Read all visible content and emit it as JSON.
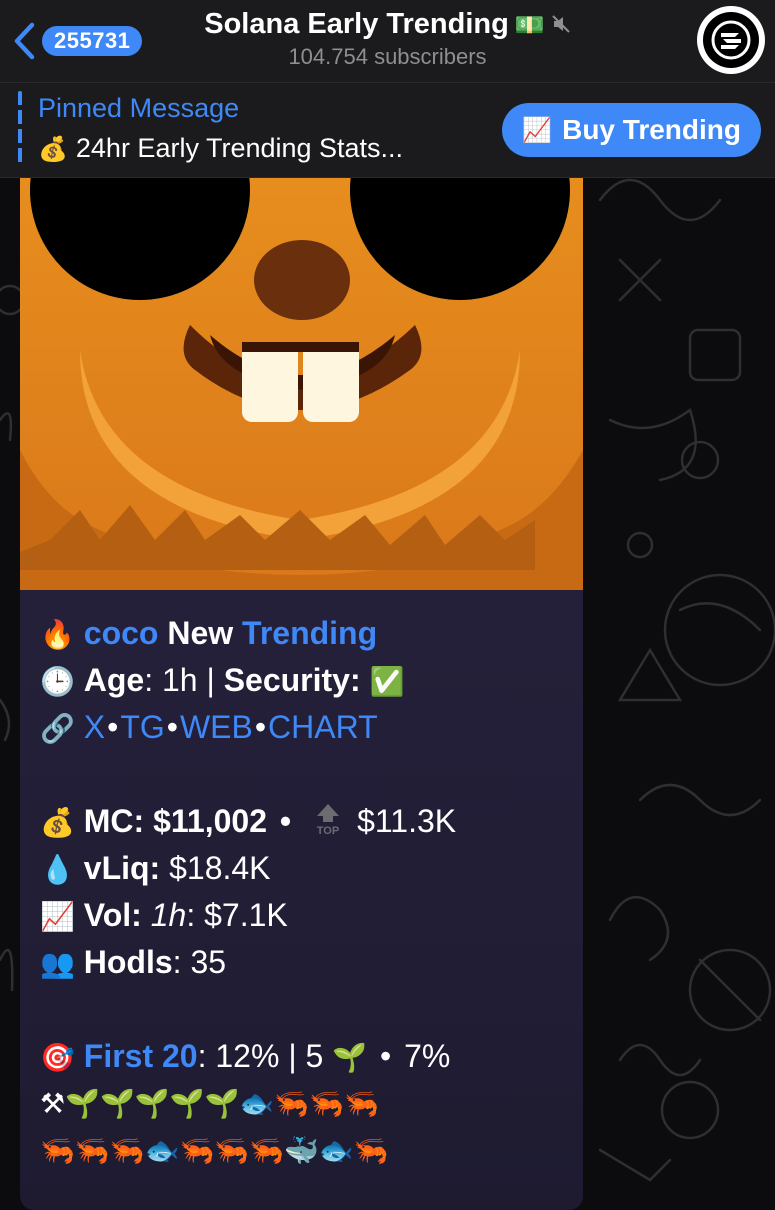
{
  "header": {
    "back_count": "255731",
    "title": "Solana Early Trending",
    "title_emoji": "💵",
    "subtitle": "104.754 subscribers"
  },
  "pinned": {
    "label": "Pinned Message",
    "emoji": "💰",
    "text": "24hr Early Trending Stats...",
    "button_emoji": "📈",
    "button_label": "Buy Trending"
  },
  "message": {
    "l1": {
      "emoji": "🔥",
      "token": "coco",
      "new": "New",
      "trending": "Trending"
    },
    "l2": {
      "emoji": "🕒",
      "age_label": "Age",
      "age_value": ": 1h | ",
      "security_label": "Security:",
      "security_emoji": "✅"
    },
    "l3": {
      "emoji": "🔗",
      "links": [
        "X",
        "TG",
        "WEB",
        "CHART"
      ],
      "sep": "•"
    },
    "l4": {
      "emoji": "💰",
      "mc": "MC: $11,002",
      "dot": "•",
      "top_label": "TOP",
      "top_value": "$11.3K"
    },
    "l5": {
      "emoji": "💧",
      "label": "vLiq:",
      "value": "$18.4K"
    },
    "l6": {
      "emoji": "📈",
      "label": "Vol:",
      "period": "1h",
      "value": ": $7.1K"
    },
    "l7": {
      "emoji": "👥",
      "label": "Hodls",
      "value": ": 35"
    },
    "l8": {
      "emoji": "🎯",
      "label": "First 20",
      "value": ": 12% | 5",
      "sprout": "🌱",
      "dot": "•",
      "pct": "7%"
    },
    "l9": "⚒🌱🌱🌱🌱🌱🐟🦐🦐🦐",
    "l10": "🦐🦐🦐🐟🦐🦐🦐🐳🐟🦐"
  },
  "colors": {
    "accent": "#3e88f7",
    "header_bg": "#1b1b1d",
    "bubble_bg": "#252038"
  },
  "icons": [
    "chevron-left-icon",
    "mute-icon",
    "channel-avatar-icon",
    "top-arrow-icon"
  ]
}
